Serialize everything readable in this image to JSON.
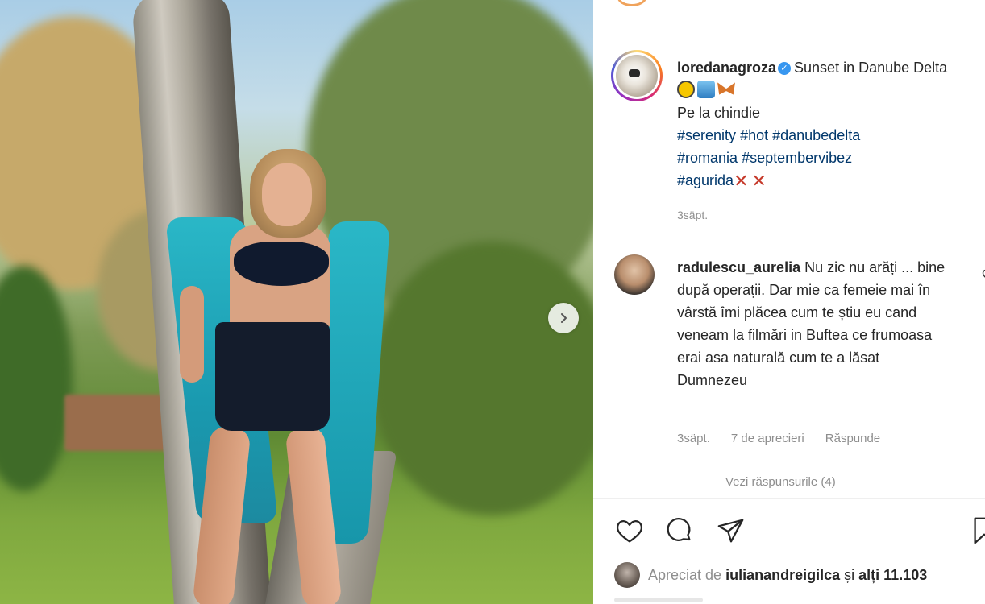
{
  "post": {
    "author": "loredanagroza",
    "caption_text": "Sunset in Danube Delta",
    "caption_line2": "Pe la chindie",
    "hashtags_line1": [
      "#serenity",
      "#hot",
      "#danubedelta"
    ],
    "hashtags_line2": [
      "#romania",
      "#septembervibez"
    ],
    "hashtags_line3": [
      "#agurida"
    ],
    "time_ago": "3säpt."
  },
  "comment": {
    "username": "radulescu_aurelia",
    "text": "Nu zic nu arăți ... bine după operații. Dar mie ca femeie mai în vârstă îmi plăcea cum te știu eu cand veneam la filmări in Buftea ce frumoasa erai asa naturală cum te a lăsat Dumnezeu",
    "time_ago": "3säpt.",
    "likes": "7 de aprecieri",
    "reply_label": "Răspunde",
    "view_replies": "Vezi răspunsurile (4)"
  },
  "likes": {
    "prefix": "Apreciat de",
    "user": "iulianandreigilca",
    "conjunction": "și",
    "others": "alți 11.103"
  },
  "icons": {
    "verified": "verified-badge-icon",
    "next": "chevron-right-icon",
    "like": "heart-icon",
    "comment": "comment-bubble-icon",
    "share": "paper-plane-icon",
    "save": "bookmark-icon"
  },
  "colors": {
    "hashtag": "#00376b",
    "verified": "#3897f0",
    "muted": "#8e8e8e",
    "text": "#262626"
  }
}
